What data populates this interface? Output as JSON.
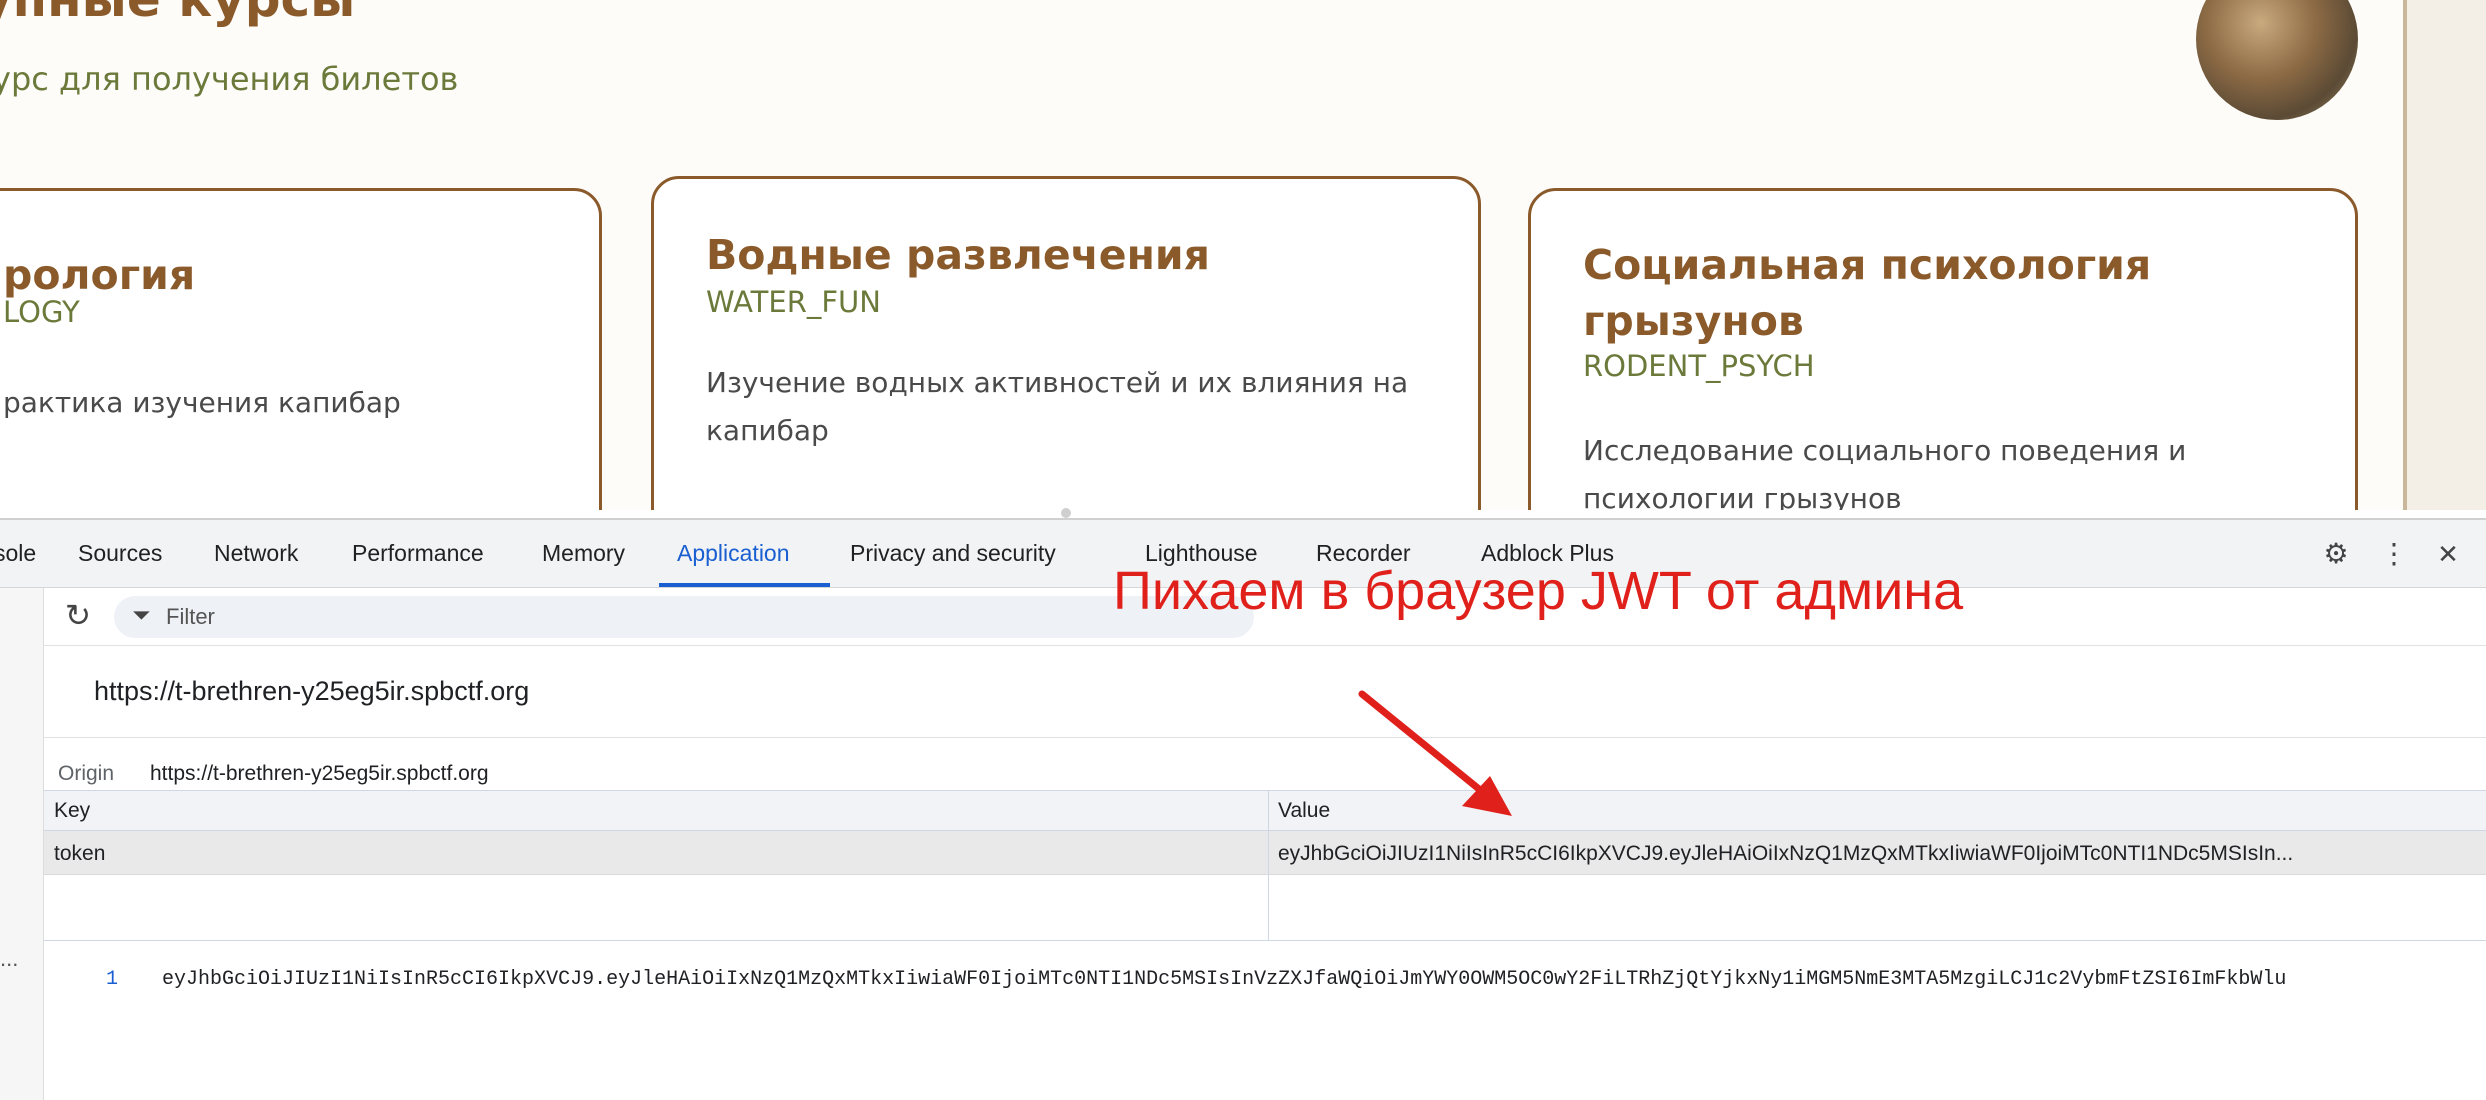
{
  "page": {
    "title": "упные курсы",
    "subtitle": "урс для получения билетов",
    "cards": [
      {
        "title": "рология",
        "code": "LOGY",
        "description": "рактика изучения капибар"
      },
      {
        "title": "Водные развлечения",
        "code": "WATER_FUN",
        "description": "Изучение водных активностей и их влияния на капибар"
      },
      {
        "title": "Социальная психология грызунов",
        "code": "RODENT_PSYCH",
        "description": "Исследование социального поведения и психологии грызунов"
      }
    ]
  },
  "devtools": {
    "tabs": [
      {
        "label": "sole"
      },
      {
        "label": "Sources"
      },
      {
        "label": "Network"
      },
      {
        "label": "Performance"
      },
      {
        "label": "Memory"
      },
      {
        "label": "Application"
      },
      {
        "label": "Privacy and security"
      },
      {
        "label": "Lighthouse"
      },
      {
        "label": "Recorder"
      },
      {
        "label": "Adblock Plus"
      }
    ],
    "active_tab": "Application",
    "icons": {
      "settings": "⚙",
      "more": "⋮",
      "close": "✕",
      "refresh": "↻",
      "filter": "⏷"
    },
    "filter_placeholder": "Filter",
    "origin_header": "https://t-brethren-y25eg5ir.spbctf.org",
    "origin_label": "Origin",
    "origin_value": "https://t-brethren-y25eg5ir.spbctf.org",
    "table": {
      "headers": {
        "key": "Key",
        "value": "Value"
      },
      "rows": [
        {
          "key": "token",
          "value": "eyJhbGciOiJIUzI1NiIsInR5cCI6IkpXVCJ9.eyJleHAiOiIxNzQ1MzQxMTkxIiwiaWF0IjoiMTc0NTI1NDc5MSIsIn..."
        }
      ]
    },
    "preview": {
      "line_number": "1",
      "code": "eyJhbGciOiJIUzI1NiIsInR5cCI6IkpXVCJ9.eyJleHAiOiIxNzQ1MzQxMTkxIiwiaWF0IjoiMTc0NTI1NDc5MSIsInVzZXJfaWQiOiJmYWY0OWM5OC0wY2FiLTRhZjQtYjkxNy1iMGM5NmE3MTA5MzgiLCJ1c2VybmFtZSI6ImFkbWlu"
    },
    "left_more": "..."
  },
  "annotation": {
    "text": "Пихаем в браузер JWT от админа",
    "color": "#e0201b"
  },
  "colors": {
    "brand_brown": "#8b5a2b",
    "olive": "#6b7a3a",
    "devtools_accent": "#1a5fd1"
  }
}
